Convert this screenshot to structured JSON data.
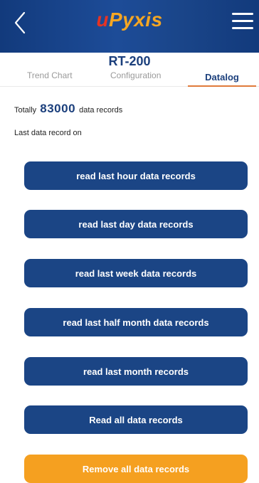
{
  "header": {
    "logo_u": "u",
    "logo_rest": "Pyxis",
    "back_icon": "chevron-left-icon",
    "menu_icon": "hamburger-menu-icon"
  },
  "device": {
    "title": "RT-200"
  },
  "tabs": [
    {
      "label": "Trend Chart",
      "active": false
    },
    {
      "label": "Configuration",
      "active": false
    },
    {
      "label": "Datalog",
      "active": true
    }
  ],
  "summary": {
    "prefix": "Totally",
    "count": "83000",
    "suffix": "data records",
    "last_record_label": "Last data record on"
  },
  "buttons": {
    "last_hour": "read last hour data records",
    "last_day": "read last day data records",
    "last_week": "read last week data records",
    "last_half_month": "read last half month data records",
    "last_month": "read last month records",
    "all": "Read all data records",
    "remove_all": "Remove all data records"
  },
  "colors": {
    "primary": "#1b4585",
    "accent": "#f5a020",
    "tab_underline": "#e07a3a"
  }
}
